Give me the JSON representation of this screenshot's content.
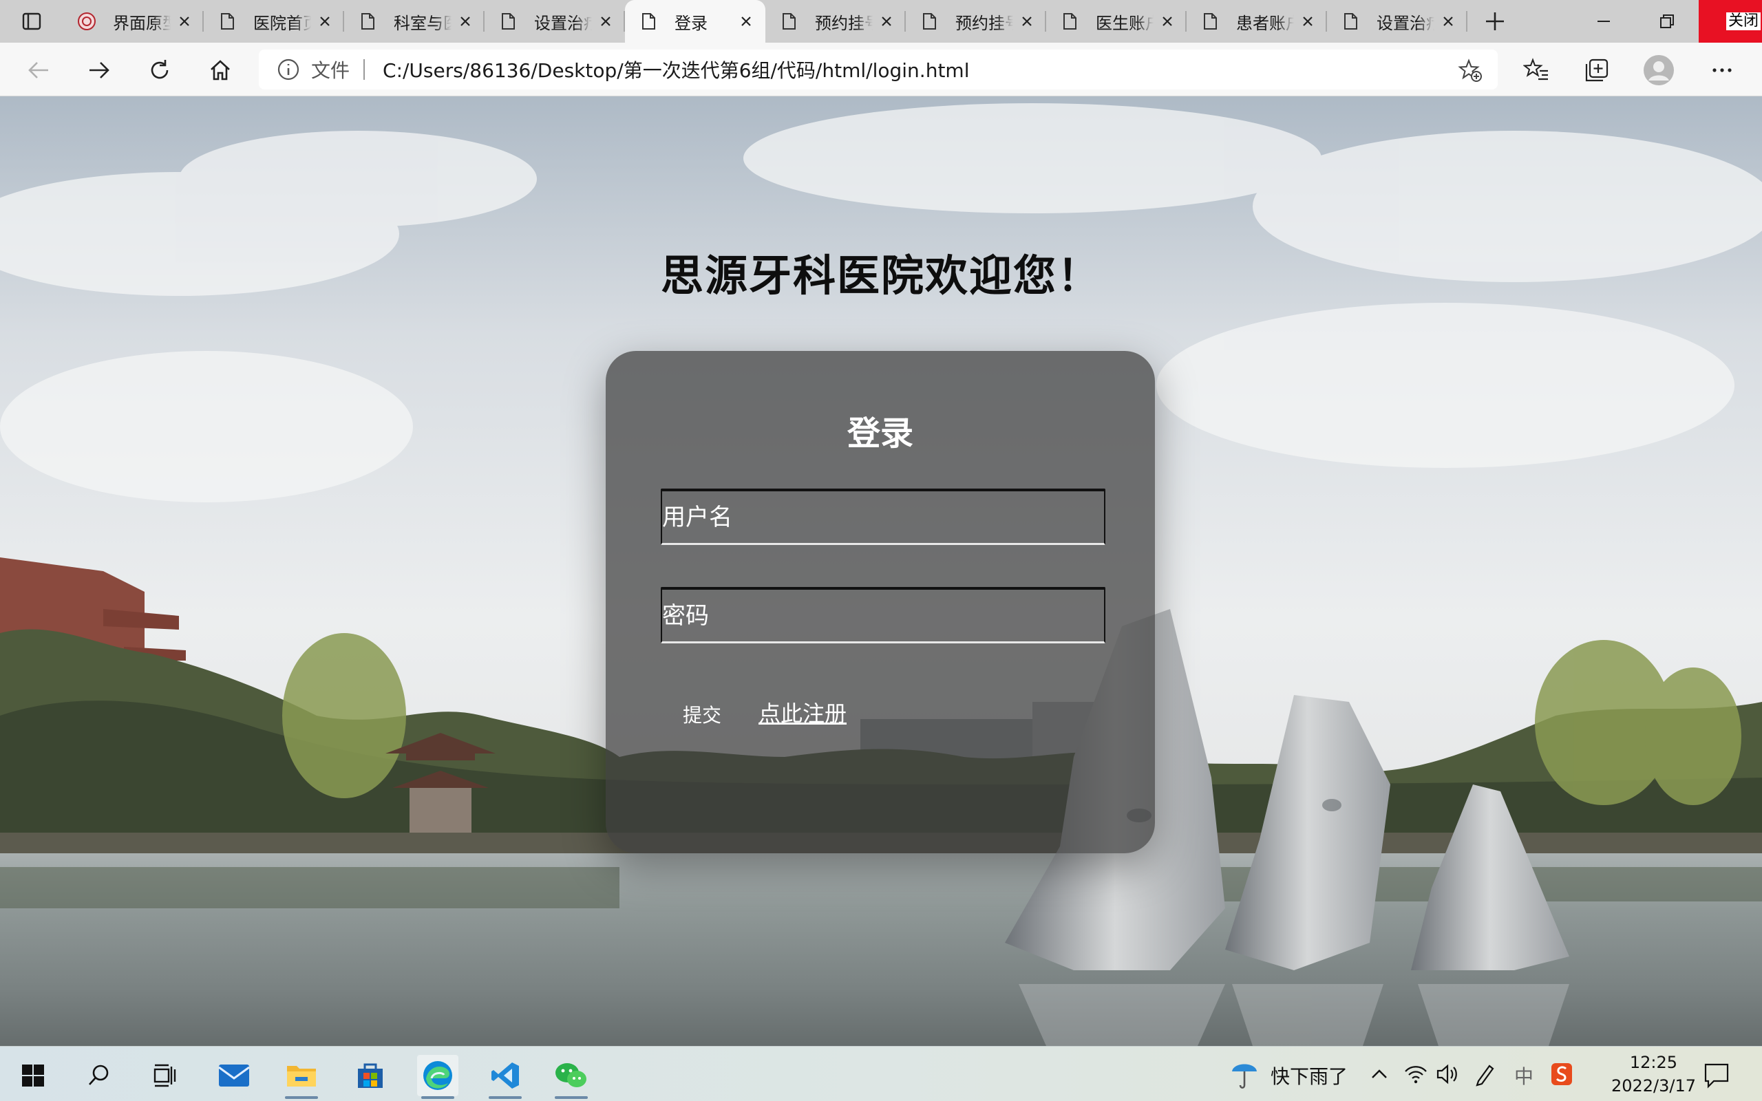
{
  "browser": {
    "tabs": [
      {
        "title": "界面原型",
        "favicon": "university-seal-icon",
        "active": false
      },
      {
        "title": "医院首页",
        "favicon": "page-icon",
        "active": false
      },
      {
        "title": "科室与医生",
        "favicon": "page-icon",
        "active": false
      },
      {
        "title": "设置治疗",
        "favicon": "page-icon",
        "active": false
      },
      {
        "title": "登录",
        "favicon": "page-icon",
        "active": true
      },
      {
        "title": "预约挂号",
        "favicon": "page-icon",
        "active": false
      },
      {
        "title": "预约挂号",
        "favicon": "page-icon",
        "active": false
      },
      {
        "title": "医生账户",
        "favicon": "page-icon",
        "active": false
      },
      {
        "title": "患者账户",
        "favicon": "page-icon",
        "active": false
      },
      {
        "title": "设置治疗",
        "favicon": "page-icon",
        "active": false
      }
    ],
    "close_label": "关闭",
    "address": {
      "scheme_label": "文件",
      "url": "C:/Users/86136/Desktop/第一次迭代第6组/代码/html/login.html"
    }
  },
  "page": {
    "welcome": "思源牙科医院欢迎您！",
    "login": {
      "title": "登录",
      "username_placeholder": "用户名",
      "password_placeholder": "密码",
      "submit_label": "提交",
      "register_link": "点此注册"
    }
  },
  "taskbar": {
    "apps": [
      "start-icon",
      "search-icon",
      "task-view-icon",
      "mail-icon",
      "file-explorer-icon",
      "store-icon",
      "edge-icon",
      "vscode-icon",
      "wechat-icon"
    ],
    "weather": "快下雨了",
    "ime": "中",
    "time": "12:25",
    "date": "2022/3/17"
  }
}
